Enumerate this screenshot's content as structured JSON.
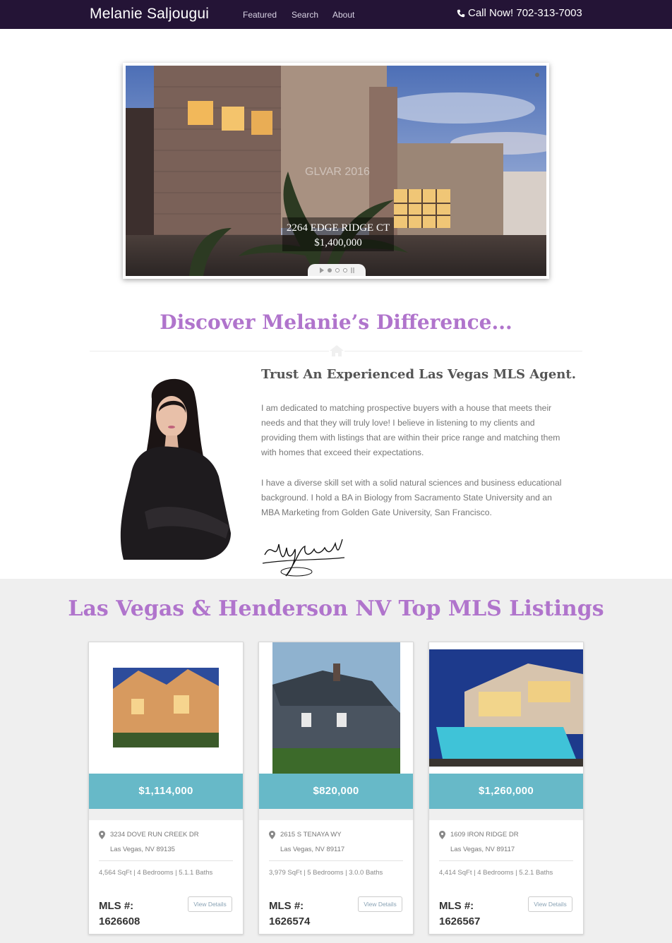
{
  "navbar": {
    "brand": "Melanie Saljougui",
    "links": [
      "Featured",
      "Search",
      "About"
    ],
    "call_label": "Call Now! 702-313-7003"
  },
  "hero": {
    "address": "2264 EDGE RIDGE CT",
    "price": "$1,400,000",
    "slide_count": 3,
    "active_slide": 1
  },
  "discover": {
    "title": "Discover Melanie’s Difference...",
    "heading": "Trust An Experienced Las Vegas MLS Agent.",
    "paragraph_1": "I am dedicated to matching prospective buyers with a house that meets their needs and that they will truly love! I believe in listening to my clients and providing them with listings that are within their price range and matching them with homes that exceed their expectations.",
    "paragraph_2": "I have a diverse skill set with a solid natural sciences and business educational background. I hold a BA in Biology from Sacramento State University and an MBA Marketing from Golden Gate University, San Francisco."
  },
  "listings": {
    "title": "Las Vegas & Henderson NV Top MLS Listings",
    "mls_label": "MLS #:",
    "view_label": "View Details",
    "cards": [
      {
        "price": "$1,114,000",
        "street": "3234 DOVE RUN CREEK DR",
        "city": "Las Vegas, NV 89135",
        "specs": "4,564 SqFt | 4 Bedrooms | 5.1.1 Baths",
        "mls": "1626608"
      },
      {
        "price": "$820,000",
        "street": "2615 S TENAYA WY",
        "city": "Las Vegas, NV 89117",
        "specs": "3,979 SqFt | 5 Bedrooms | 3.0.0 Baths",
        "mls": "1626574"
      },
      {
        "price": "$1,260,000",
        "street": "1609 IRON RIDGE DR",
        "city": "Las Vegas, NV 89117",
        "specs": "4,414 SqFt | 4 Bedrooms | 5.2.1 Baths",
        "mls": "1626567"
      }
    ]
  },
  "colors": {
    "navbar": "#241436",
    "accent_purple": "#b074cc",
    "price_bar": "#67b9c8"
  }
}
